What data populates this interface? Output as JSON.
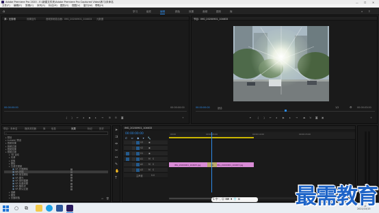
{
  "window": {
    "title": "Adobe Premiere Pro 2020 - E:\\新建文件夹\\Adobe Premiere Pro Captured Video\\练习\\未命名",
    "min": "—",
    "max": "☐",
    "close": "✕"
  },
  "menu": [
    "文件(F)",
    "编辑(E)",
    "剪辑(C)",
    "序列(S)",
    "标记(M)",
    "图形(G)",
    "视图(V)",
    "窗口(W)",
    "帮助(H)"
  ],
  "workspaces": [
    "学习",
    "组件",
    "编辑",
    "颜色",
    "效果",
    "音频",
    "图形",
    "库"
  ],
  "source_panel": {
    "tabs": [
      "源：无剪辑",
      "效果控件",
      "音频剪辑混合器：IMG_20200901_104633",
      "元数据"
    ],
    "timecode_left": "00:00:00:00",
    "timecode_right": "00:00:00:00"
  },
  "program_panel": {
    "tab": "节目：IMG_20200901_104633",
    "timecode": "00:00:00:00",
    "fit": "适合",
    "ratio": "1/2",
    "timecode_right": "00:00:03:00"
  },
  "project_panel": {
    "tabs": [
      "项目：未命名",
      "媒体浏览器",
      "库",
      "信息",
      "效果",
      "标记",
      "历史"
    ],
    "tree": [
      {
        "label": "预设",
        "indent": 0
      },
      {
        "label": "Lumetri 预设",
        "indent": 0
      },
      {
        "label": "音频效果",
        "indent": 0
      },
      {
        "label": "音频过渡",
        "indent": 0
      },
      {
        "label": "视频效果",
        "indent": 0
      },
      {
        "label": "视频过渡",
        "indent": 0
      },
      {
        "label": "3D 运动",
        "indent": 1
      },
      {
        "label": "内滑",
        "indent": 1
      },
      {
        "label": "划像",
        "indent": 1
      },
      {
        "label": "擦除",
        "indent": 1
      },
      {
        "label": "沉浸式视频",
        "indent": 1
      },
      {
        "label": "VR 光圈擦除",
        "indent": 2
      },
      {
        "label": "VR 光线",
        "indent": 2,
        "selected": true
      },
      {
        "label": "VR 渐变擦除",
        "indent": 2
      },
      {
        "label": "VR 漏光",
        "indent": 2
      },
      {
        "label": "VR 球形模糊",
        "indent": 2
      },
      {
        "label": "VR 色度泄漏",
        "indent": 2
      },
      {
        "label": "VR 随机块",
        "indent": 2
      },
      {
        "label": "VR 默认过渡",
        "indent": 2
      },
      {
        "label": "溶解",
        "indent": 1
      },
      {
        "label": "缩放",
        "indent": 1
      },
      {
        "label": "页面剥落",
        "indent": 1
      }
    ]
  },
  "timeline": {
    "tab": "IMG_20200901_104633",
    "timecode": "00:00:00:00",
    "ruler": [
      "00:00",
      "00:00:05:00",
      "00:00:10:00",
      "00:00:15:00"
    ],
    "tracks": [
      "V3",
      "V2",
      "V1",
      "A1",
      "A2",
      "A3"
    ],
    "master": "主声道",
    "master_val": "0.0",
    "clips": [
      {
        "label": "IMG_20200901_104633.jpg"
      },
      {
        "label": "IMG_20200901_104633.jpg"
      }
    ],
    "transition": "VR"
  },
  "taskbar": {
    "time": "9:02",
    "date": "2021/10/15"
  },
  "watermark": "最需教育"
}
